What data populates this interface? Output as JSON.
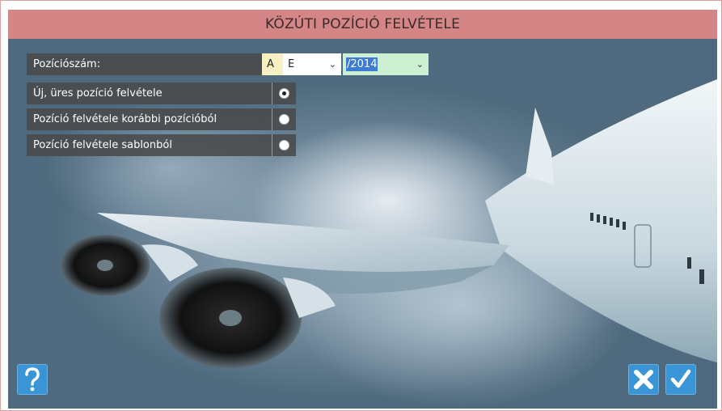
{
  "window": {
    "title": "KÖZÚTI POZÍCIÓ FELVÉTELE"
  },
  "form": {
    "position_label": "Pozíciószám:",
    "prefix_value": "A",
    "type_select": {
      "selected": "E"
    },
    "year_select": {
      "selected": "/2014"
    },
    "options": [
      {
        "label": "Új, üres pozíció felvétele",
        "checked": true
      },
      {
        "label": "Pozíció felvétele korábbi pozícióból",
        "checked": false
      },
      {
        "label": "Pozíció felvétele sablonból",
        "checked": false
      }
    ]
  },
  "buttons": {
    "help_icon": "question-mark-icon",
    "cancel_icon": "x-icon",
    "ok_icon": "checkmark-icon"
  },
  "colors": {
    "titlebar": "#d48686",
    "button": "#3a95d6",
    "panel": "#4a4a4a"
  }
}
